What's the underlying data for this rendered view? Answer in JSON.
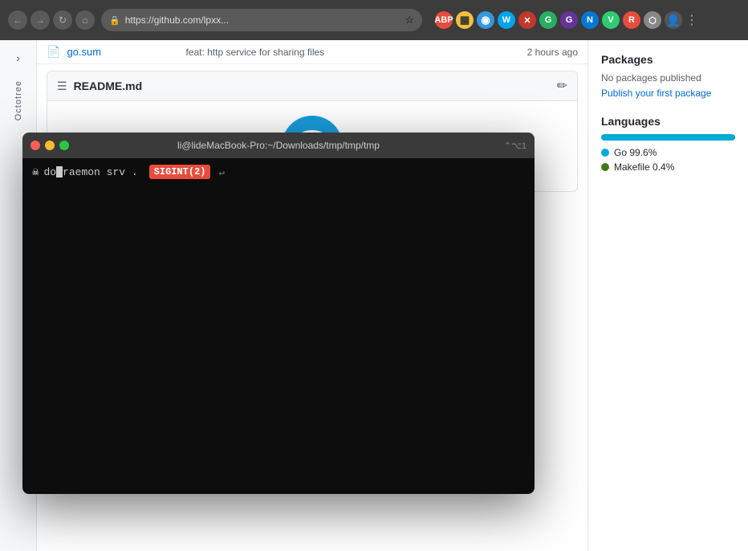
{
  "browser": {
    "url": "https://github.com/lpxx...",
    "nav_back": "←",
    "nav_forward": "→",
    "nav_refresh": "↻",
    "nav_home": "⌂",
    "star_label": "☆",
    "extensions": [
      {
        "id": "abp",
        "label": "ABP",
        "class": "ext-abp"
      },
      {
        "id": "yellow",
        "label": "▦",
        "class": "ext-yellow"
      },
      {
        "id": "blue",
        "label": "◉",
        "class": "ext-blue"
      },
      {
        "id": "ms",
        "label": "W",
        "class": "ext-ms"
      },
      {
        "id": "red",
        "label": "✕",
        "class": "ext-red"
      },
      {
        "id": "green",
        "label": "G",
        "class": "ext-green"
      },
      {
        "id": "gecko",
        "label": "G",
        "class": "ext-gecko"
      },
      {
        "id": "n",
        "label": "N",
        "class": "ext-n"
      },
      {
        "id": "v",
        "label": "V",
        "class": "ext-v"
      },
      {
        "id": "rp",
        "label": "R",
        "class": "ext-rp"
      },
      {
        "id": "puzzle",
        "label": "⬡",
        "class": "ext-puzzle"
      },
      {
        "id": "user",
        "label": "👤",
        "class": "ext-user"
      }
    ]
  },
  "file_row": {
    "name": "go.sum",
    "commit": "feat: http service for sharing files",
    "time": "2 hours ago"
  },
  "readme": {
    "title": "README.md",
    "edit_icon": "✏"
  },
  "sidebar": {
    "packages_title": "Packages",
    "no_packages": "No packages published",
    "publish_link": "Publish your first package",
    "languages_title": "Languages",
    "languages": [
      {
        "name": "Go",
        "percent": "99.6%",
        "bar_width": 99.6,
        "class": "lang-dot-go"
      },
      {
        "name": "Makefile",
        "percent": "0.4%",
        "bar_width": 0.4,
        "class": "lang-dot-makefile"
      }
    ],
    "go_bar_width": "99.6",
    "makefile_bar_width": "0.4"
  },
  "octotree": {
    "label": "Octotree",
    "toggle_icon": "›"
  },
  "terminal": {
    "title": "li@lideMacBook-Pro:~/Downloads/tmp/tmp/tmp",
    "shortcut": "⌃⌥1",
    "prompt_icon": "☠",
    "cursor_text_before": "do",
    "cursor_char": "r",
    "command_after": "aemon srv .",
    "sigint": "SIGINT(2)",
    "return_icon": "↵"
  }
}
